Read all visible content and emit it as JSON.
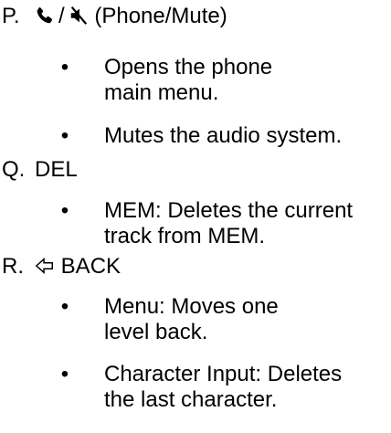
{
  "entries": [
    {
      "letter": "P.",
      "title_after_icons": "(Phone/Mute)",
      "separator": "/",
      "icons": [
        "phone-icon",
        "mute-icon"
      ],
      "bullets": [
        {
          "line1": "Opens the phone",
          "line2": "main menu."
        },
        {
          "line1": "Mutes the audio system.",
          "line2": ""
        }
      ]
    },
    {
      "letter": "Q.",
      "title": "DEL",
      "bullets": [
        {
          "line1": "MEM: Deletes the current",
          "line2": "track from MEM."
        }
      ]
    },
    {
      "letter": "R.",
      "title": "BACK",
      "icons": [
        "back-arrow-icon"
      ],
      "bullets": [
        {
          "line1": "Menu: Moves one",
          "line2": "level back."
        },
        {
          "line1": "Character Input: Deletes",
          "line2": "the last character."
        }
      ]
    }
  ],
  "bullet_glyph": "•"
}
